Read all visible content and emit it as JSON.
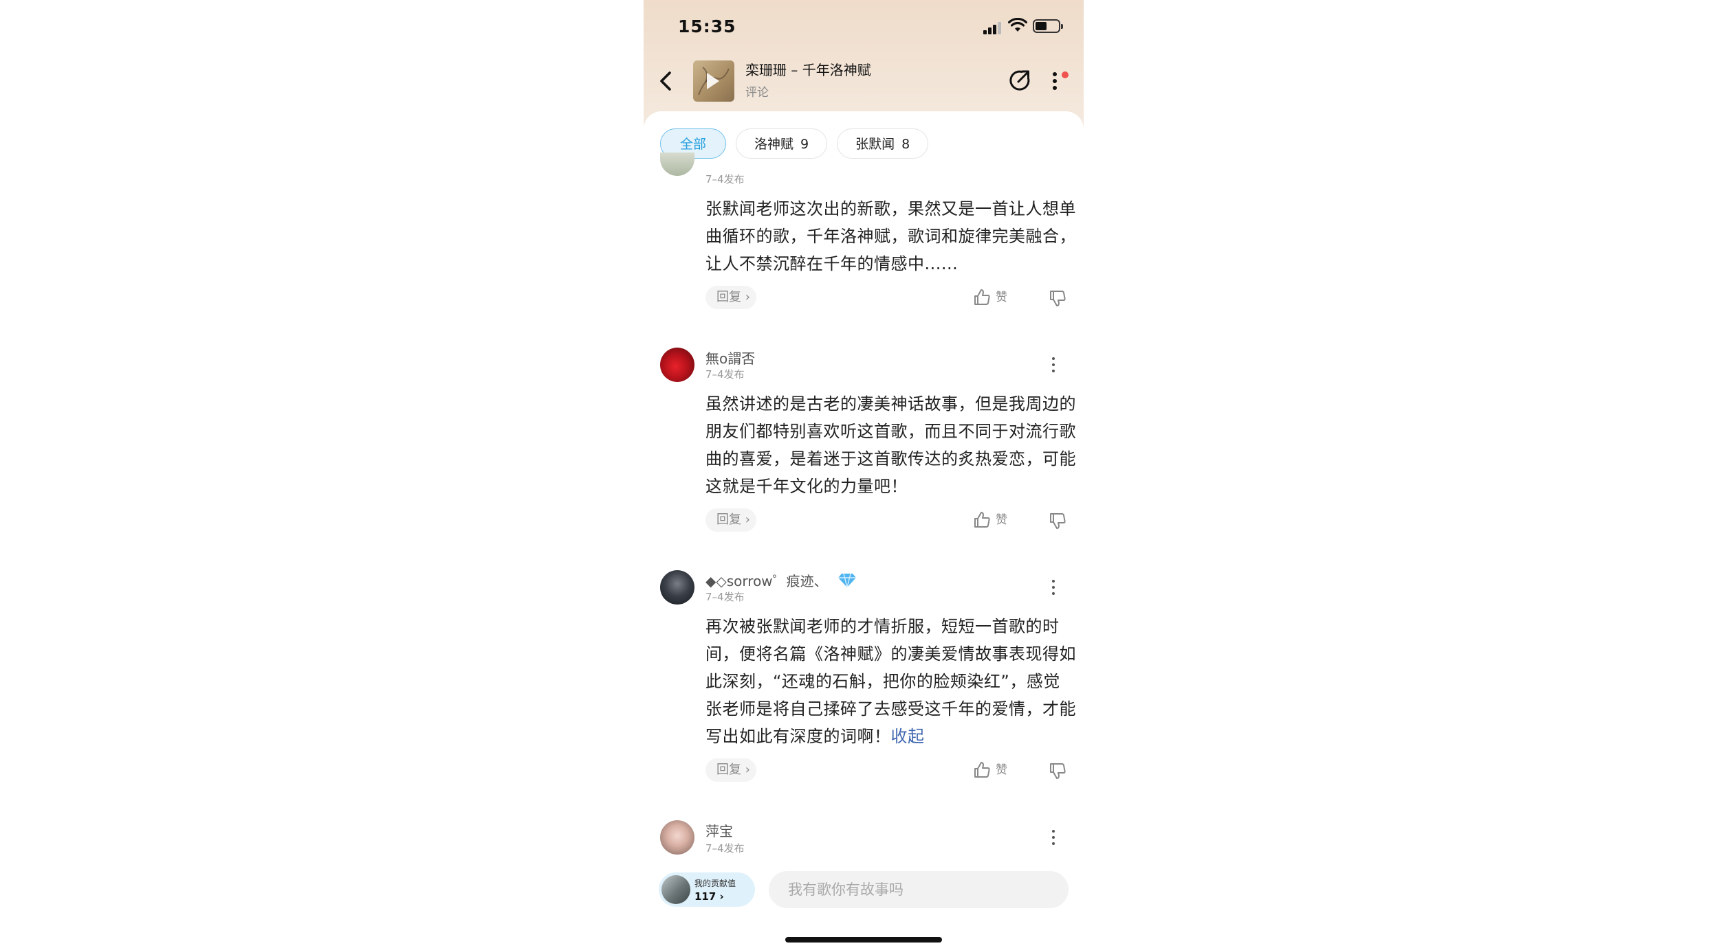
{
  "status": {
    "time": "15:35"
  },
  "header": {
    "title": "栾珊珊 – 千年洛神赋",
    "subtitle": "评论"
  },
  "tabs": [
    {
      "label": "全部",
      "count": ""
    },
    {
      "label": "洛神赋",
      "count": "9"
    },
    {
      "label": "张默闻",
      "count": "8"
    }
  ],
  "comments": [
    {
      "username": "",
      "date": "7–4发布",
      "text": "张默闻老师这次出的新歌，果然又是一首让人想单曲循环的歌，千年洛神赋，歌词和旋律完美融合，让人不禁沉醉在千年的情感中......",
      "collapse_label": "",
      "reply_label": "回复 ›",
      "like_label": "赞"
    },
    {
      "username": "無o謂否",
      "date": "7–4发布",
      "text": "虽然讲述的是古老的凄美神话故事，但是我周边的朋友们都特别喜欢听这首歌，而且不同于对流行歌曲的喜爱，是着迷于这首歌传达的炙热爱恋，可能这就是千年文化的力量吧！",
      "collapse_label": "",
      "reply_label": "回复 ›",
      "like_label": "赞"
    },
    {
      "username": "◆◇sorrow゜痕迹、",
      "date": "7–4发布",
      "text": "再次被张默闻老师的才情折服，短短一首歌的时间，便将名篇《洛神赋》的凄美爱情故事表现得如此深刻，“还魂的石斛，把你的脸颊染红”，感觉张老师是将自己揉碎了去感受这千年的爱情，才能写出如此有深度的词啊！",
      "collapse_label": "收起",
      "reply_label": "回复 ›",
      "like_label": "赞"
    },
    {
      "username": "萍宝",
      "date": "7–4发布"
    }
  ],
  "footer": {
    "contribution_label": "我的贡献值",
    "contribution_value": "117 ›",
    "input_placeholder": "我有歌你有故事吗"
  },
  "icons": {
    "back": "chevron-left-icon",
    "share": "share-icon",
    "more": "more-vertical-icon",
    "like": "thumbs-up-icon",
    "dislike": "thumbs-down-icon",
    "diamond_badge": "diamond-icon"
  },
  "colors": {
    "accent": "#27a0dd",
    "collapse_link": "#3f66b0",
    "notification_dot": "#f0524f"
  }
}
